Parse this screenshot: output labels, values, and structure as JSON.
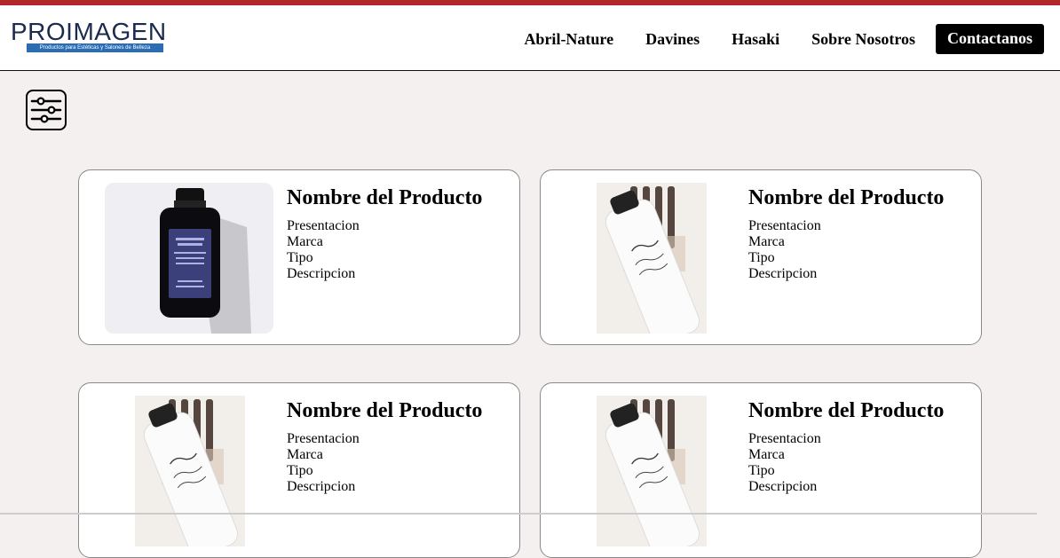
{
  "header": {
    "logo_text": "PROIMAGEN",
    "logo_tagline": "Productos para Estéticas y Salones de Belleza",
    "nav": [
      "Abril-Nature",
      "Davines",
      "Hasaki",
      "Sobre Nosotros"
    ],
    "cta_label": "Contactanos"
  },
  "filter": {
    "icon": "sliders-icon"
  },
  "products": [
    {
      "title": "Nombre del Producto",
      "presentacion": "Presentacion",
      "marca": "Marca",
      "tipo": "Tipo",
      "descripcion": "Descripcion",
      "image": "dark-shampoo-bottle"
    },
    {
      "title": "Nombre del Producto",
      "presentacion": "Presentacion",
      "marca": "Marca",
      "tipo": "Tipo",
      "descripcion": "Descripcion",
      "image": "white-spray-can"
    },
    {
      "title": "Nombre del Producto",
      "presentacion": "Presentacion",
      "marca": "Marca",
      "tipo": "Tipo",
      "descripcion": "Descripcion",
      "image": "white-spray-can"
    },
    {
      "title": "Nombre del Producto",
      "presentacion": "Presentacion",
      "marca": "Marca",
      "tipo": "Tipo",
      "descripcion": "Descripcion",
      "image": "white-spray-can"
    }
  ],
  "colors": {
    "accent_bar": "#b3262a",
    "background": "#f3f0ef",
    "logo_blue": "#2a6db5"
  }
}
